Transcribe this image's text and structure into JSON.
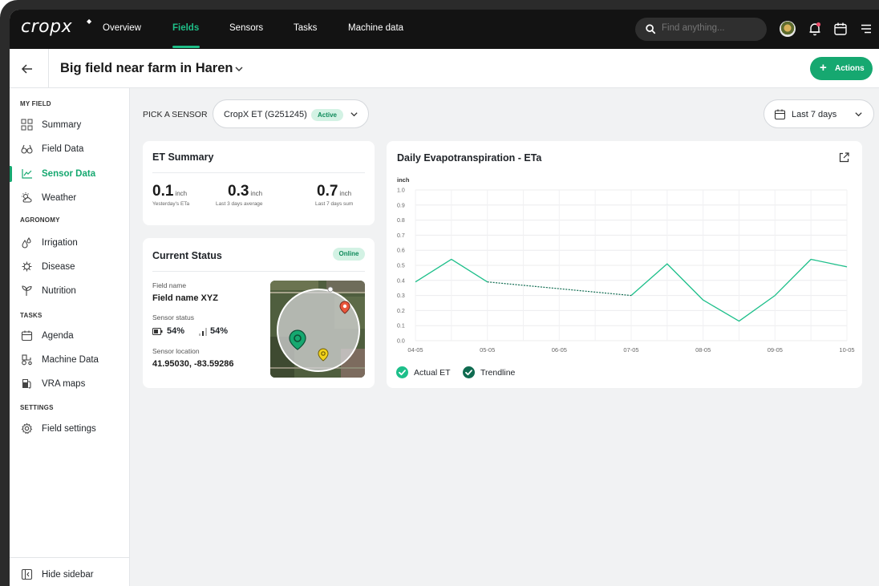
{
  "app": {
    "logo": "cropx"
  },
  "nav": {
    "items": [
      {
        "label": "Overview",
        "active": false
      },
      {
        "label": "Fields",
        "active": true
      },
      {
        "label": "Sensors",
        "active": false
      },
      {
        "label": "Tasks",
        "active": false
      },
      {
        "label": "Machine data",
        "active": false
      }
    ]
  },
  "search": {
    "placeholder": "Find anything..."
  },
  "header": {
    "title": "Big field near farm in Haren",
    "actions_label": "Actions"
  },
  "sidebar": {
    "sections": [
      {
        "label": "MY FIELD",
        "items": [
          {
            "label": "Summary",
            "icon": "grid-icon"
          },
          {
            "label": "Field Data",
            "icon": "binoculars-icon"
          },
          {
            "label": "Sensor Data",
            "icon": "chart-line-icon",
            "active": true
          },
          {
            "label": "Weather",
            "icon": "weather-icon"
          }
        ]
      },
      {
        "label": "AGRONOMY",
        "items": [
          {
            "label": "Irrigation",
            "icon": "droplets-icon"
          },
          {
            "label": "Disease",
            "icon": "virus-icon"
          },
          {
            "label": "Nutrition",
            "icon": "plant-icon"
          }
        ]
      },
      {
        "label": "TASKS",
        "items": [
          {
            "label": "Agenda",
            "icon": "calendar-icon"
          },
          {
            "label": "Machine Data",
            "icon": "tractor-icon"
          },
          {
            "label": "VRA maps",
            "icon": "fuel-icon"
          }
        ]
      },
      {
        "label": "SETTINGS",
        "items": [
          {
            "label": "Field settings",
            "icon": "gear-icon"
          }
        ]
      }
    ],
    "hide_label": "Hide sidebar"
  },
  "sensor_picker": {
    "label": "PICK A SENSOR",
    "value": "CropX ET (G251245)",
    "status": "Active"
  },
  "date_range": {
    "value": "Last 7 days"
  },
  "et_summary": {
    "title": "ET Summary",
    "metrics": [
      {
        "value": "0.1",
        "unit": "inch",
        "sub": "Yesterday's ETa"
      },
      {
        "value": "0.3",
        "unit": "inch",
        "sub": "Last 3 days average"
      },
      {
        "value": "0.7",
        "unit": "inch",
        "sub": "Last 7 days sum"
      }
    ]
  },
  "status": {
    "title": "Current Status",
    "badge": "Online",
    "field_name_label": "Field name",
    "field_name": "Field name XYZ",
    "sensor_status_label": "Sensor status",
    "battery": "54%",
    "signal": "54%",
    "location_label": "Sensor location",
    "location": "41.95030, -83.59286"
  },
  "chart": {
    "title": "Daily Evapotranspiration - ETa",
    "unit": "inch",
    "colors": {
      "actual": "#1dbf8a",
      "trend": "#0f6b50"
    }
  },
  "chart_data": {
    "type": "line",
    "title": "Daily Evapotranspiration - ETa",
    "ylabel": "inch",
    "ylim": [
      0,
      1.0
    ],
    "yticks": [
      "0.0",
      "0.1",
      "0.2",
      "0.3",
      "0.4",
      "0.5",
      "0.6",
      "0.7",
      "0.8",
      "0.9",
      "1.0"
    ],
    "xticks": [
      "04-05",
      "05-05",
      "06-05",
      "07-05",
      "08-05",
      "09-05",
      "10-05"
    ],
    "grid": true,
    "legend": "bottom-left",
    "series": [
      {
        "name": "Actual ET",
        "x": [
          0,
          0.5,
          1,
          3,
          3.5,
          4,
          4.5,
          5,
          5.5,
          6
        ],
        "y": [
          0.39,
          0.54,
          0.39,
          0.3,
          0.51,
          0.27,
          0.13,
          0.3,
          0.54,
          0.49
        ],
        "dashed_between": [
          2,
          3
        ]
      },
      {
        "name": "Trendline",
        "x": [
          1,
          3
        ],
        "y": [
          0.39,
          0.3
        ]
      }
    ]
  }
}
